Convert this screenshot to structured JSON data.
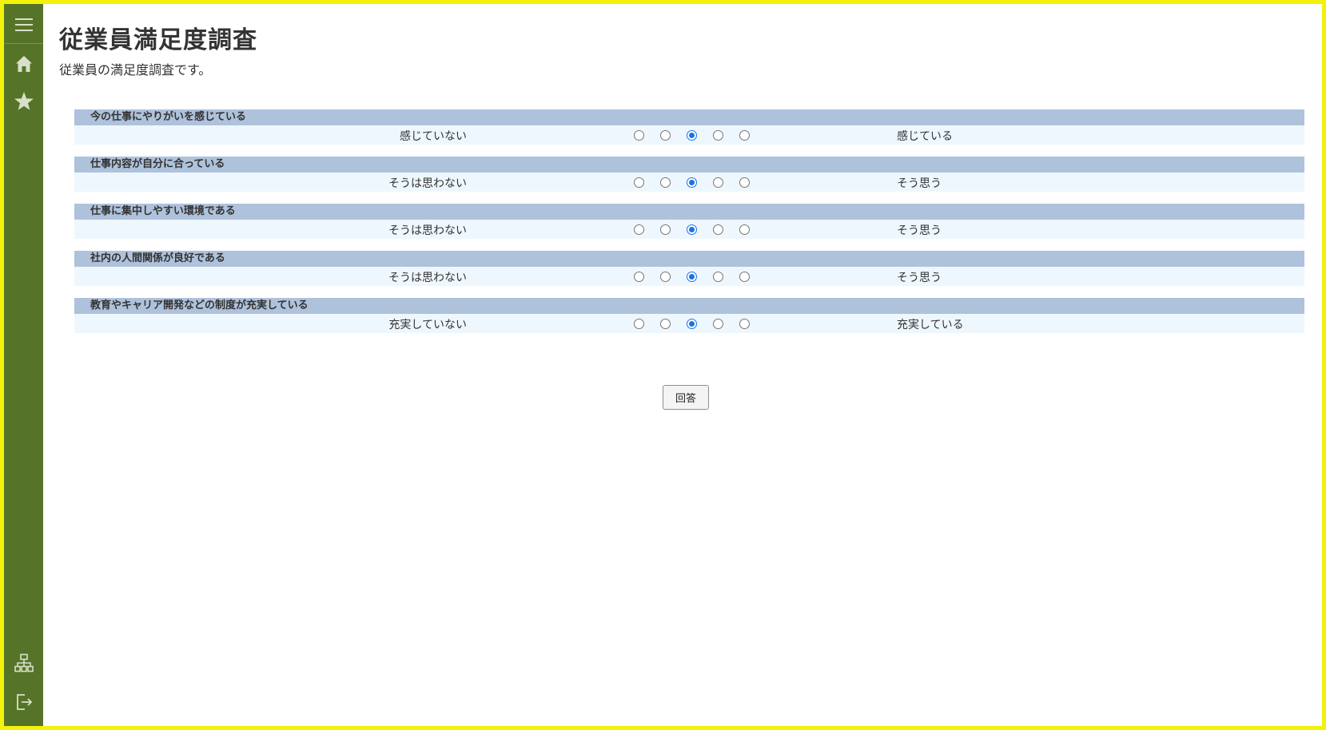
{
  "sidebar": {
    "items": [
      {
        "icon": "menu-icon"
      },
      {
        "icon": "home-icon"
      },
      {
        "icon": "star-icon"
      },
      {
        "icon": "sitemap-icon"
      },
      {
        "icon": "logout-icon"
      }
    ],
    "bg_color": "#567428",
    "icon_color": "#d8e0c8"
  },
  "page": {
    "title": "従業員満足度調査",
    "description": "従業員の満足度調査です。"
  },
  "questions": [
    {
      "question": "今の仕事にやりがいを感じている",
      "low_label": "感じていない",
      "high_label": "感じている",
      "selected": 3
    },
    {
      "question": "仕事内容が自分に合っている",
      "low_label": "そうは思わない",
      "high_label": "そう思う",
      "selected": 3
    },
    {
      "question": "仕事に集中しやすい環境である",
      "low_label": "そうは思わない",
      "high_label": "そう思う",
      "selected": 3
    },
    {
      "question": "社内の人間関係が良好である",
      "low_label": "そうは思わない",
      "high_label": "そう思う",
      "selected": 3
    },
    {
      "question": "教育やキャリア開発などの制度が充実している",
      "low_label": "充実していない",
      "high_label": "充実している",
      "selected": 3
    }
  ],
  "scale_points": 5,
  "submit_label": "回答",
  "colors": {
    "frame_border": "#f2f20a",
    "question_header_bg": "#afc2dc",
    "answer_row_bg": "#eef7fe",
    "radio_selected": "#1a73e8"
  }
}
